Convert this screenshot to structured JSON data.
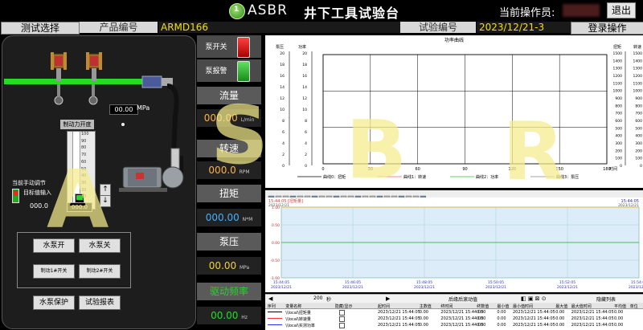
{
  "header": {
    "logo_text": "ASBR",
    "logo_badge": "1",
    "title": "井下工具试验台",
    "operator_label": "当前操作员:",
    "exit_label": "退出"
  },
  "infobar": {
    "test_select": "测试选择",
    "product_no_label": "产品编号",
    "product_no_value": "ARMD166",
    "exp_no_label": "试验编号",
    "exp_no_value": "2023/12/21-3",
    "login_label": "登录操作"
  },
  "left_panel": {
    "pressure_value": "00.00",
    "pressure_unit": "MPa",
    "actuator_label": "制动力开度",
    "scale": [
      "100",
      "90",
      "80",
      "70",
      "60",
      "50",
      "40",
      "30",
      "20",
      "10",
      "0"
    ],
    "manual_title": "当前手动调节",
    "target_label": "目标值输入",
    "target_value": "000.0",
    "current_value": "000.0",
    "buttons": {
      "pump_on": "水泵开",
      "pump_off": "水泵关",
      "brake1": "制动1#开关",
      "brake2": "制动2#开关",
      "pump_protect": "水泵保护",
      "test_report": "试验报表"
    }
  },
  "middle": {
    "pump_switch": "泵开关",
    "pump_alarm": "泵报警",
    "flow_title": "流量",
    "flow_value": "000.00",
    "flow_unit": "L/min",
    "speed_title": "转速",
    "speed_value": "000.0",
    "speed_unit": "RPM",
    "torque_title": "扭矩",
    "torque_value": "000.00",
    "torque_unit": "N*M",
    "pressure_title": "泵压",
    "pressure_value": "00.00",
    "pressure_unit": "MPa",
    "power_title": "驱动频率",
    "power_value": "00.00",
    "power_unit": "Hz"
  },
  "chart_data": [
    {
      "type": "line",
      "title": "功率曲线",
      "xlabel": "时间",
      "x_ticks": [
        "0",
        "30",
        "60",
        "90",
        "120",
        "150",
        "180"
      ],
      "xlim": [
        0,
        180
      ],
      "left_axis_1": {
        "label": "泵压",
        "ticks": [
          "20",
          "18",
          "16",
          "14",
          "12",
          "10",
          "8",
          "6",
          "4",
          "2",
          "0"
        ]
      },
      "left_axis_2": {
        "label": "功率",
        "ticks": [
          "20",
          "18",
          "16",
          "14",
          "12",
          "10",
          "8",
          "6",
          "4",
          "2",
          "0"
        ]
      },
      "right_axis_1": {
        "label": "扭矩",
        "ticks": [
          "1500",
          "1400",
          "1300",
          "1200",
          "1100",
          "1000",
          "900",
          "800",
          "700",
          "600",
          "500",
          "400",
          "300",
          "200",
          "100",
          "0"
        ]
      },
      "right_axis_2": {
        "label": "转速",
        "ticks": [
          "1500",
          "1400",
          "1300",
          "1200",
          "1100",
          "1000",
          "900",
          "800",
          "700",
          "600",
          "500",
          "400",
          "300",
          "200",
          "100",
          "0"
        ]
      },
      "legend": [
        "曲线0：扭矩",
        "曲线1：转速",
        "曲线2：功率",
        "曲线3：泵压"
      ],
      "series": [],
      "grid": true
    },
    {
      "type": "line",
      "title": "",
      "top_left_label": "15:44:05 [扭矩量]",
      "top_left_date": "2023/12/21",
      "top_right_label": "15:44:05",
      "top_right_date": "2023/12/21",
      "y_ticks": [
        "1.00",
        "0.50",
        "0.00",
        "-0.50",
        "-1.00"
      ],
      "ylim": [
        -1.0,
        1.0
      ],
      "x_ticks": [
        "15:44:05",
        "15:46:05",
        "15:48:05",
        "15:50:05",
        "15:52:05",
        "15:54:05"
      ],
      "x_dates": [
        "2023/12/21",
        "2023/12/21",
        "2023/12/21",
        "2023/12/21",
        "2023/12/21",
        "2023/12/21"
      ],
      "series": [
        {
          "name": "",
          "values": [
            0.0,
            0.0,
            0.0,
            0.0,
            0.0,
            0.0
          ]
        }
      ],
      "grid": true
    }
  ],
  "nav": {
    "span_value": "200",
    "span_unit": "秒",
    "mode_label": "后缘后滚动值",
    "list_label": "隐藏列表"
  },
  "table": {
    "headers": [
      "序列",
      "变量名称",
      "隐藏/显示",
      "起时间",
      "主数值",
      "终时间",
      "终数值",
      "最小值",
      "最小值时间",
      "最大值",
      "最大值时间",
      "平均值",
      "单位"
    ],
    "rows": [
      [
        "",
        "\\\\local\\扭矩量",
        "",
        "2023/12/21 15:44:05",
        "0.00",
        "2023/12/21 15:44:05",
        "0.00",
        "0.00",
        "2023/12/21 15:44:05",
        "0.00",
        "2023/12/21 15:44:05",
        "0.00",
        ""
      ],
      [
        "",
        "\\\\local\\转速量",
        "",
        "2023/12/21 15:44:05",
        "0.00",
        "2023/12/21 15:44:05",
        "0.00",
        "0.00",
        "2023/12/21 15:44:05",
        "0.00",
        "2023/12/21 15:44:05",
        "0.00",
        ""
      ],
      [
        "",
        "\\\\local\\实测功率",
        "",
        "2023/12/21 15:44:05",
        "0.00",
        "2023/12/21 15:44:05",
        "0.00",
        "0.00",
        "2023/12/21 15:44:05",
        "0.00",
        "2023/12/21 15:44:05",
        "0.00",
        ""
      ]
    ]
  },
  "watermark": [
    "A",
    "S",
    "B",
    "R"
  ],
  "colors": {
    "accent_yellow": "#f0e000",
    "value_orange": "#ffb040",
    "pipe_green": "#22dd22",
    "alarm_red": "#ff2020",
    "ok_green": "#30c030"
  }
}
